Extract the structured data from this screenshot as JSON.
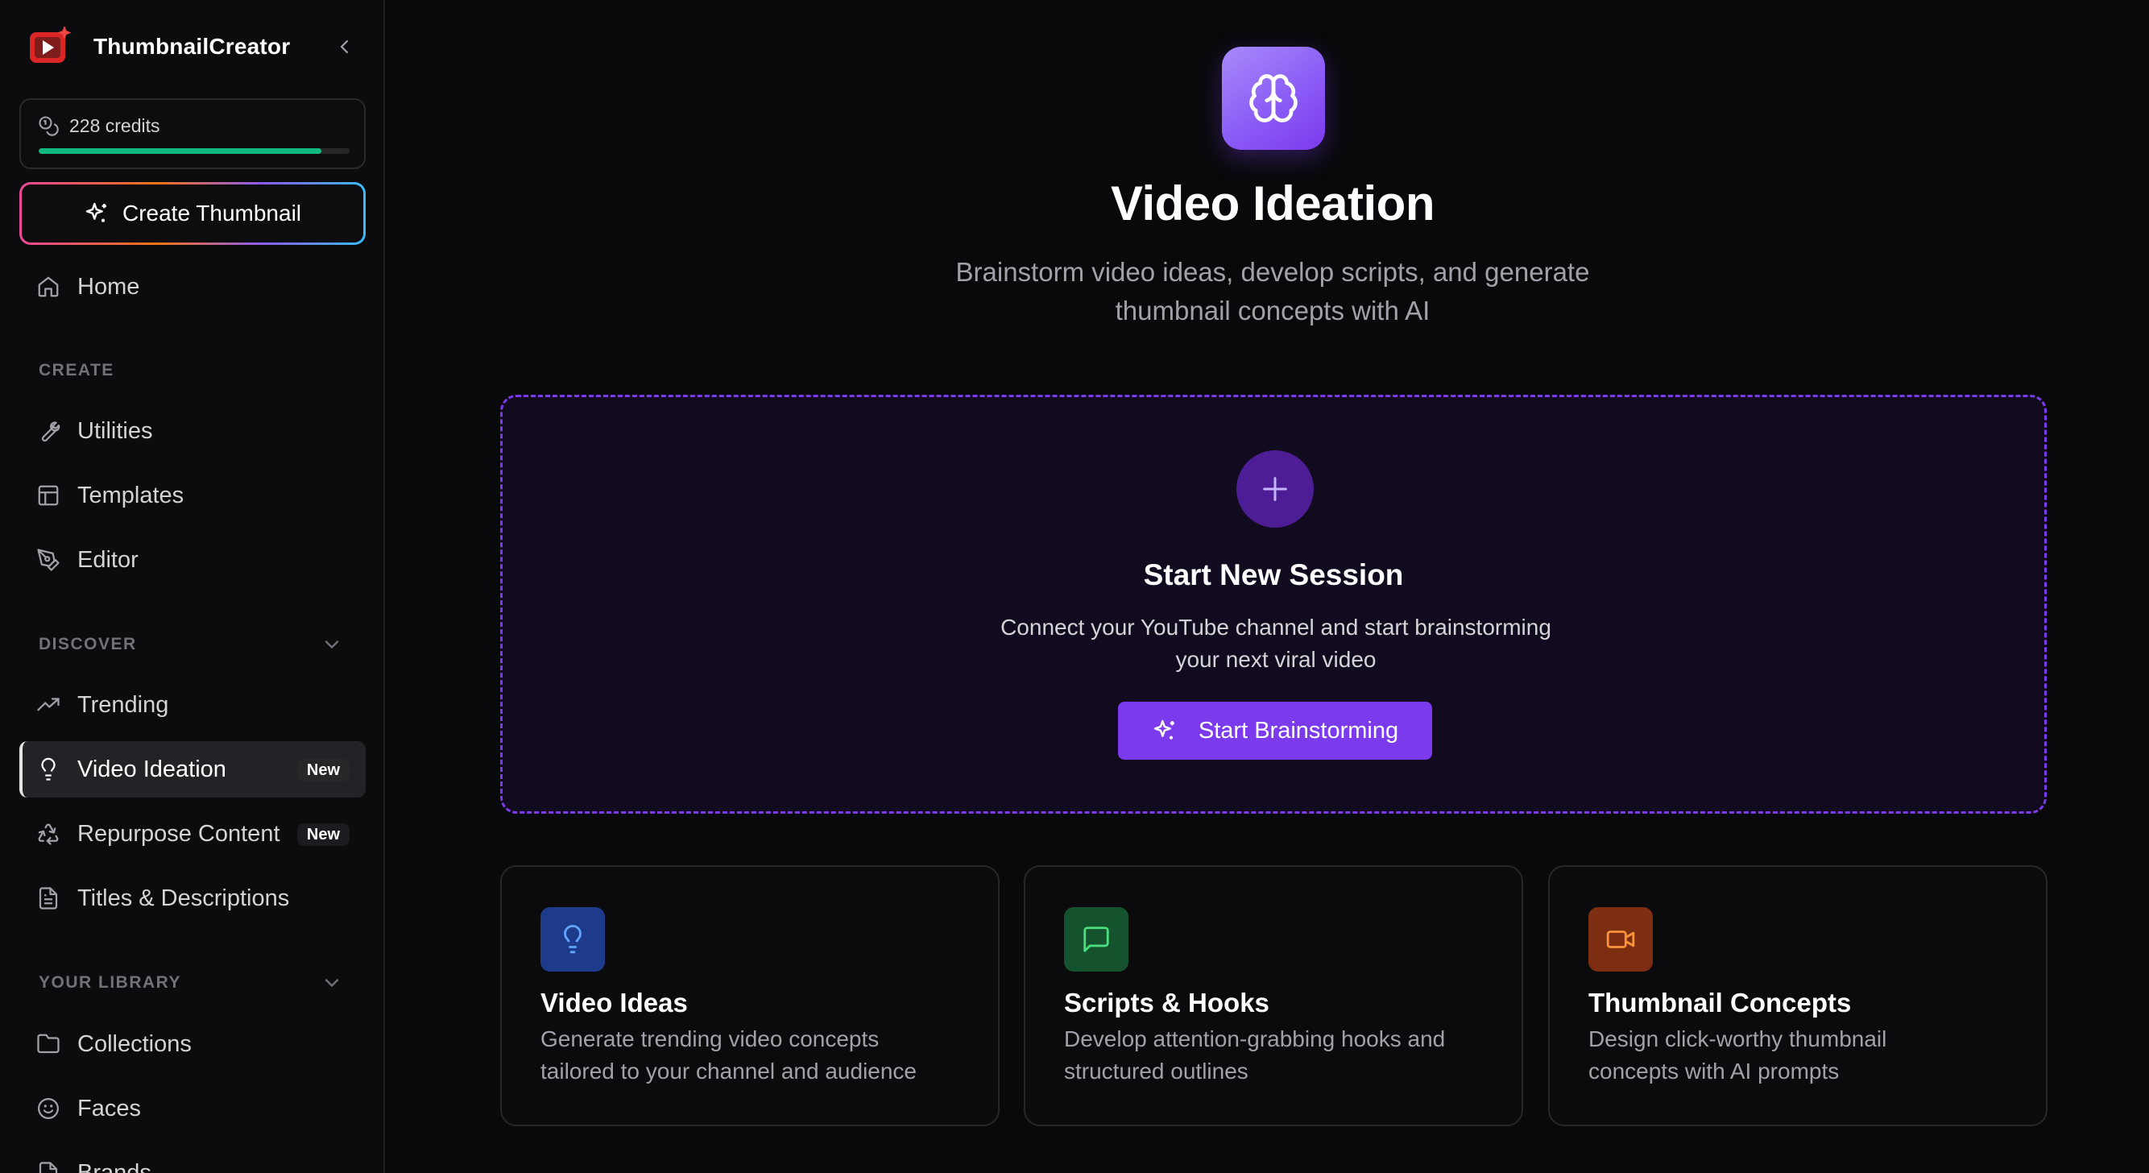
{
  "app": {
    "name": "ThumbnailCreator"
  },
  "credits": {
    "label": "228 credits",
    "progress_fraction": 0.91
  },
  "sidebar": {
    "create_button": "Create Thumbnail",
    "home": "Home",
    "sections": {
      "create": "CREATE",
      "discover": "DISCOVER",
      "library": "YOUR LIBRARY"
    },
    "create_items": [
      "Utilities",
      "Templates",
      "Editor"
    ],
    "discover_items": [
      {
        "label": "Trending",
        "badge": ""
      },
      {
        "label": "Video Ideation",
        "badge": "New",
        "active": true
      },
      {
        "label": "Repurpose Content",
        "badge": "New"
      },
      {
        "label": "Titles & Descriptions",
        "badge": ""
      }
    ],
    "library_items": [
      "Collections",
      "Faces",
      "Brands"
    ]
  },
  "main": {
    "title": "Video Ideation",
    "subtitle_line1": "Brainstorm video ideas, develop scripts, and generate",
    "subtitle_line2": "thumbnail concepts with AI",
    "session": {
      "title": "Start New Session",
      "desc_line1": "Connect your YouTube channel and start brainstorming",
      "desc_line2": "your next viral video",
      "button": "Start Brainstorming"
    },
    "features": [
      {
        "title": "Video Ideas",
        "desc_line1": "Generate trending video concepts",
        "desc_line2": "tailored to your channel and audience",
        "icon": "lightbulb-icon",
        "color": "#1e3a8a",
        "icon_color": "#60a5fa"
      },
      {
        "title": "Scripts & Hooks",
        "desc_line1": "Develop attention-grabbing hooks and",
        "desc_line2": "structured outlines",
        "icon": "message-square-icon",
        "color": "#14532d",
        "icon_color": "#4ade80"
      },
      {
        "title": "Thumbnail Concepts",
        "desc_line1": "Design click-worthy thumbnail",
        "desc_line2": "concepts with AI prompts",
        "icon": "video-camera-icon",
        "color": "#7c2d12",
        "icon_color": "#fb923c"
      }
    ]
  },
  "colors": {
    "accent": "#7c3aed",
    "background": "#09090b",
    "sidebar": "#0c0c0e",
    "credits_bar": "#10b981"
  }
}
